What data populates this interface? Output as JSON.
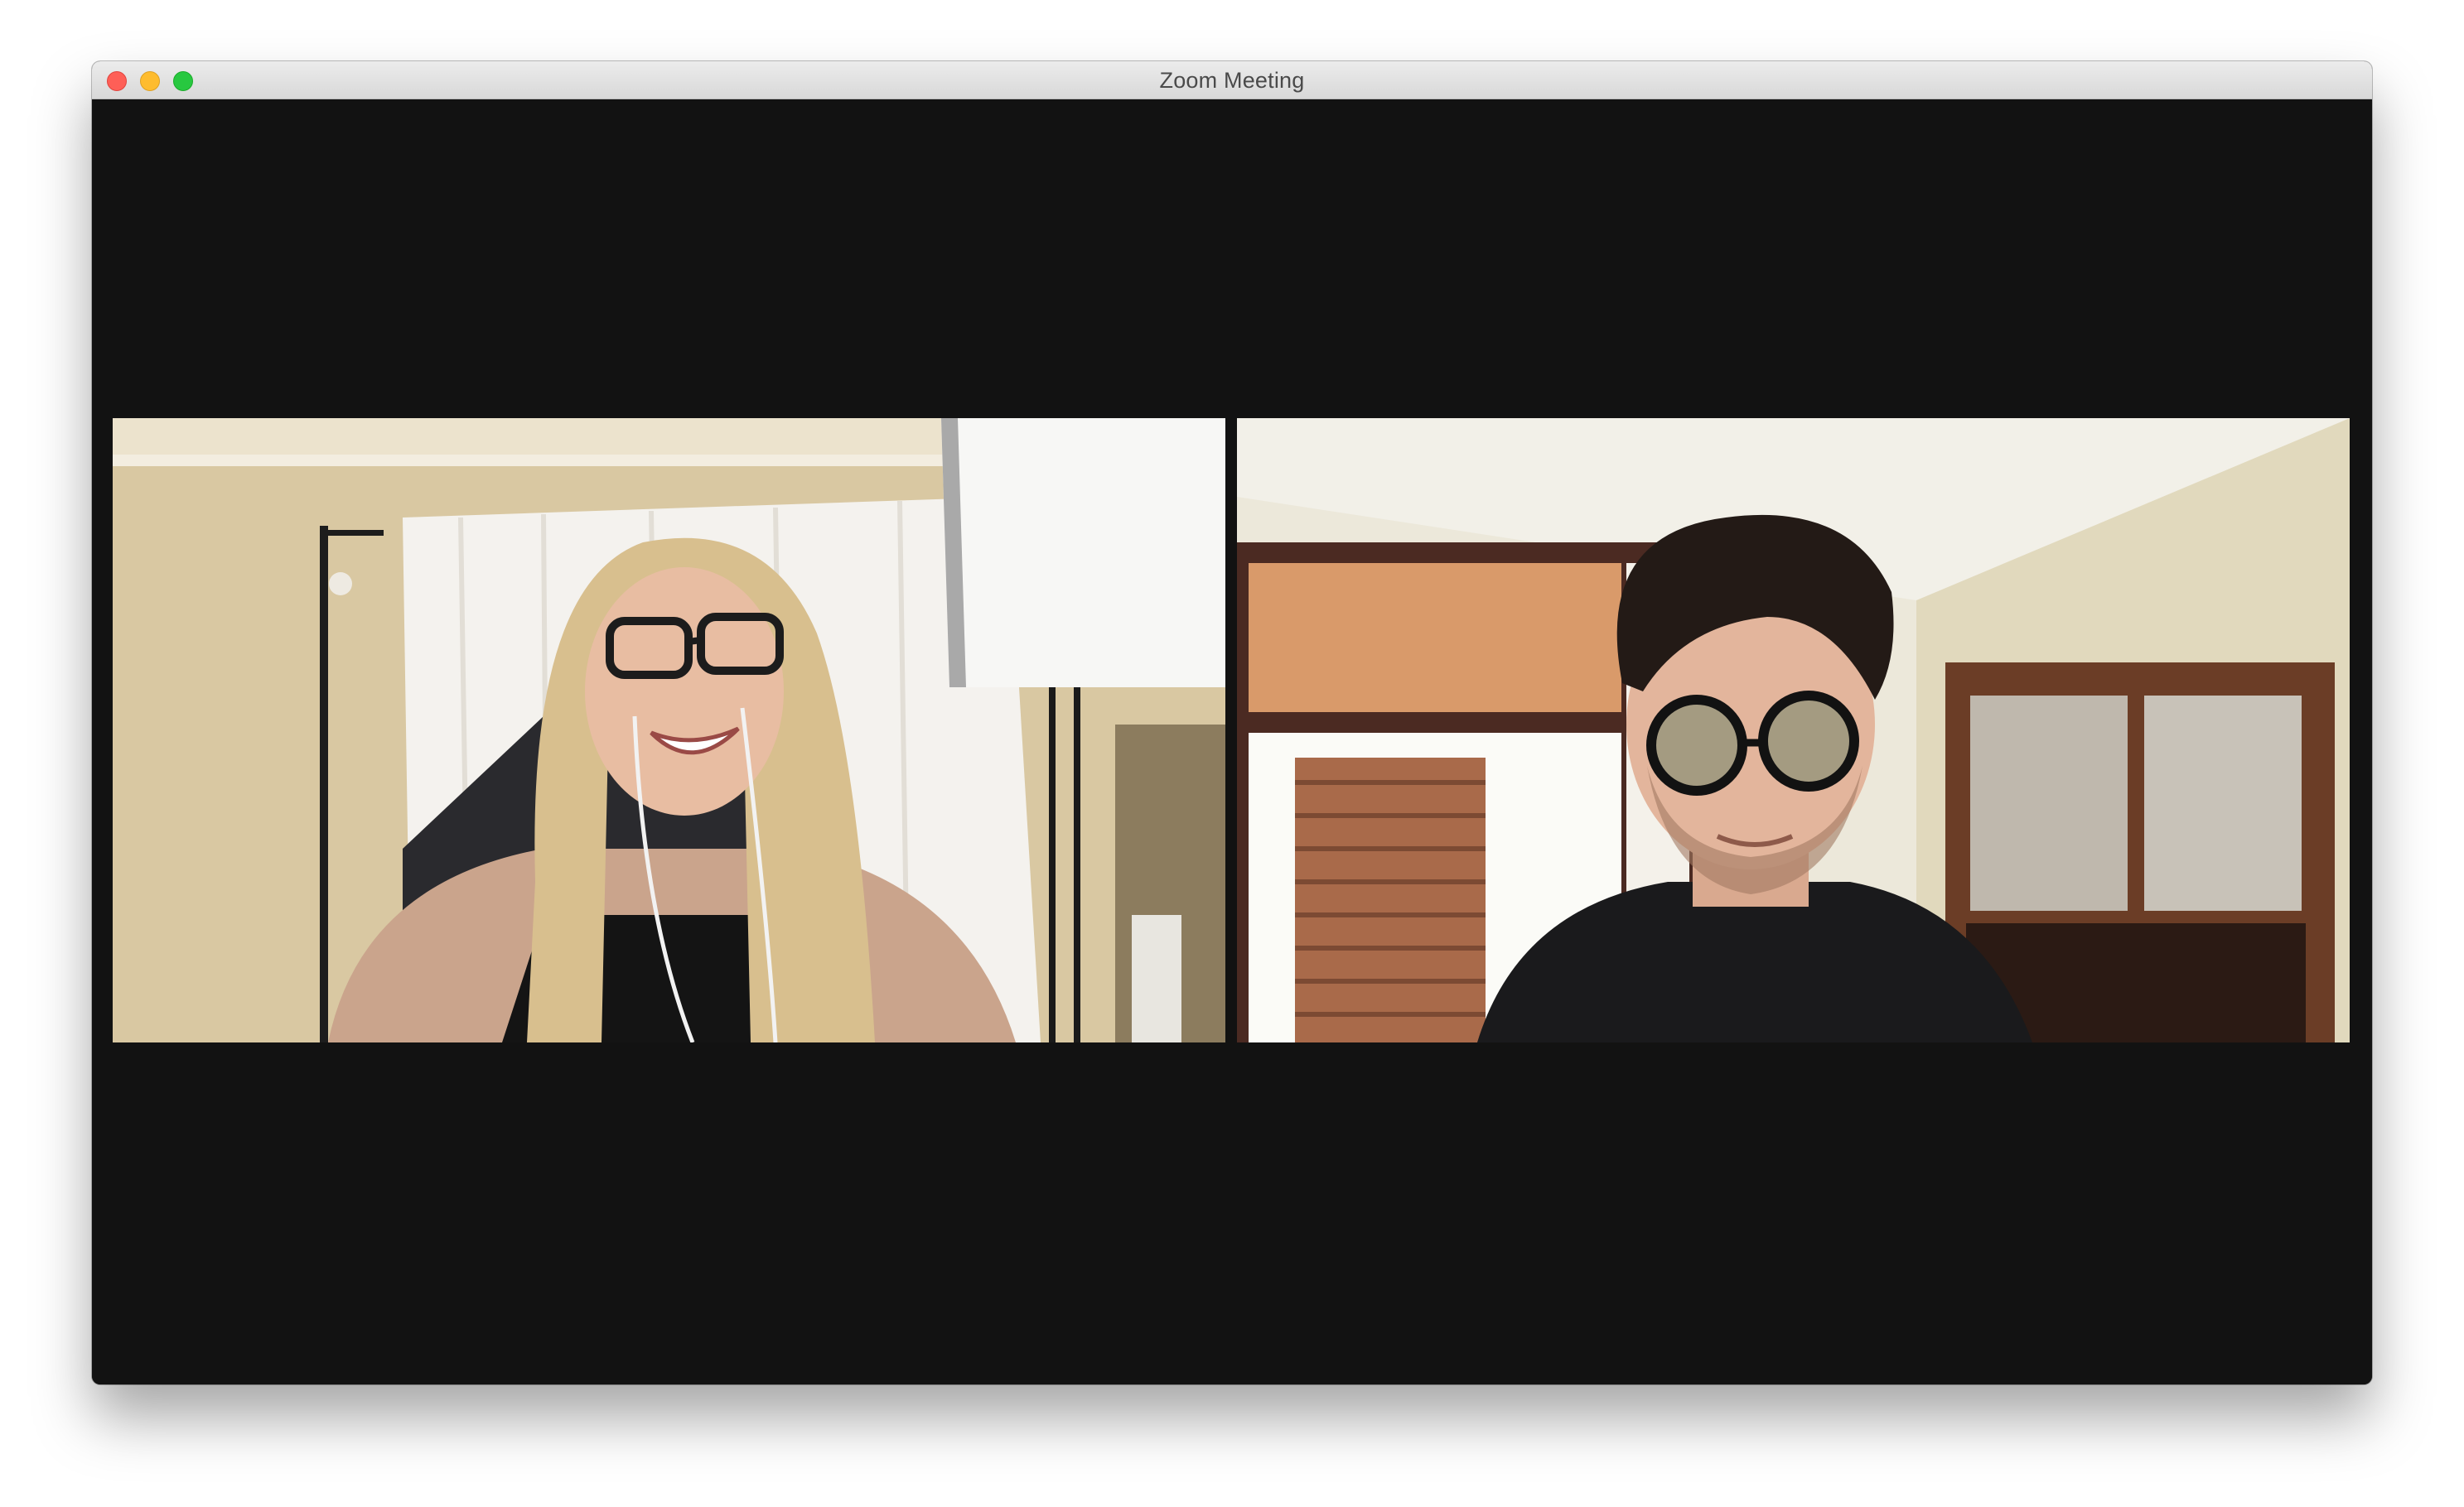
{
  "window": {
    "title": "Zoom Meeting"
  },
  "participants": [
    {
      "description": "participant-video-1"
    },
    {
      "description": "participant-video-2"
    }
  ],
  "colors": {
    "stage_background": "#121212",
    "titlebar": "#e3e3e3",
    "close": "#fe5f57",
    "minimize": "#febc2e",
    "maximize": "#28c840"
  }
}
